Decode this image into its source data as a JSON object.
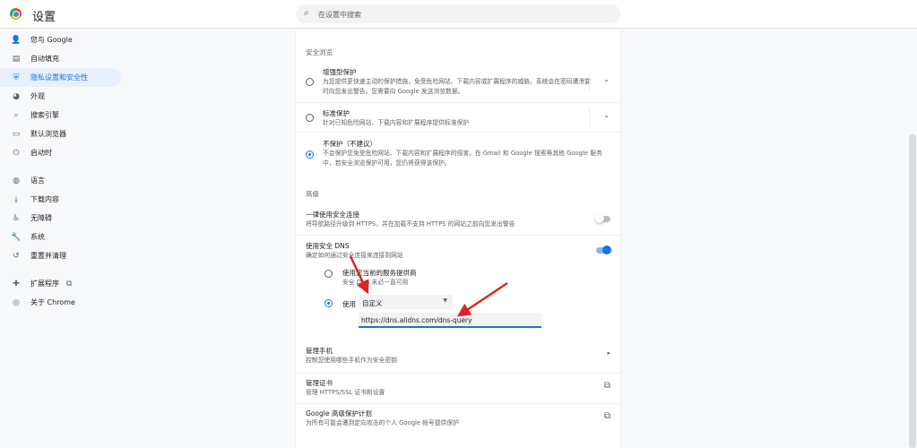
{
  "header": {
    "title": "设置",
    "search_placeholder": "在设置中搜索"
  },
  "sidebar": {
    "items": [
      {
        "label": "您与 Google",
        "icon": "person-icon",
        "glyph": "👤"
      },
      {
        "label": "自动填充",
        "icon": "clipboard-icon",
        "glyph": "▤"
      },
      {
        "label": "隐私设置和安全性",
        "icon": "shield-icon",
        "glyph": "⛨",
        "active": true
      },
      {
        "label": "外观",
        "icon": "palette-icon",
        "glyph": "◕"
      },
      {
        "label": "搜索引擎",
        "icon": "search-icon",
        "glyph": "⌕"
      },
      {
        "label": "默认浏览器",
        "icon": "browser-icon",
        "glyph": "▭"
      },
      {
        "label": "启动时",
        "icon": "power-icon",
        "glyph": "⏻"
      },
      {
        "label": "语言",
        "icon": "globe-icon",
        "glyph": "◍"
      },
      {
        "label": "下载内容",
        "icon": "download-icon",
        "glyph": "⤓"
      },
      {
        "label": "无障碍",
        "icon": "accessibility-icon",
        "glyph": "♿"
      },
      {
        "label": "系统",
        "icon": "wrench-icon",
        "glyph": "🔧"
      },
      {
        "label": "重置并清理",
        "icon": "restore-icon",
        "glyph": "↺"
      },
      {
        "label": "扩展程序",
        "icon": "puzzle-icon",
        "glyph": "✚"
      },
      {
        "label": "关于 Chrome",
        "icon": "chrome-icon",
        "glyph": "◎"
      }
    ]
  },
  "safe_browsing": {
    "title": "安全浏览",
    "options": [
      {
        "title": "增强型保护",
        "desc": "为您提供更快速主动的保护措施，免受危险网站、下载内容或扩展程序的威胁。系统会在密码遭泄露时向您发出警告。您需要向 Google 发送浏览数据。",
        "selected": false
      },
      {
        "title": "标准保护",
        "desc": "针对已知危险网站、下载内容和扩展程序提供标准保护",
        "selected": false
      },
      {
        "title": "不保护（不建议）",
        "desc": "不会保护您免受危险网站、下载内容和扩展程序的侵害。在 Gmail 和 Google 搜索等其他 Google 服务中，若安全浏览保护可用，您仍将获得该保护。",
        "selected": true
      }
    ]
  },
  "advanced": {
    "title": "高级",
    "https": {
      "title": "一律使用安全连接",
      "desc": "将导航路径升级到 HTTPS，并在加载不支持 HTTPS 的网站之前向您发出警告",
      "enabled": false
    },
    "dns": {
      "title": "使用安全 DNS",
      "desc": "确定如何通过安全连接来连接到网站",
      "enabled": true,
      "current_provider": "使用您当前的服务提供商",
      "current_provider_desc": "安全 DNS 未必一直可用",
      "use_label": "使用",
      "provider_select": "自定义",
      "custom_url": "https://dns.alidns.com/dns-query"
    },
    "phones": {
      "title": "管理手机",
      "desc": "控制您使用哪些手机作为安全密钥"
    },
    "certs": {
      "title": "管理证书",
      "desc": "管理 HTTPS/SSL 证书和设置"
    },
    "app": {
      "title": "Google 高级保护计划",
      "desc": "为所有可能会遭到定向攻击的个人 Google 帐号提供保护"
    }
  },
  "colors": {
    "accent": "#1a73e8",
    "arrow": "#e02424"
  }
}
